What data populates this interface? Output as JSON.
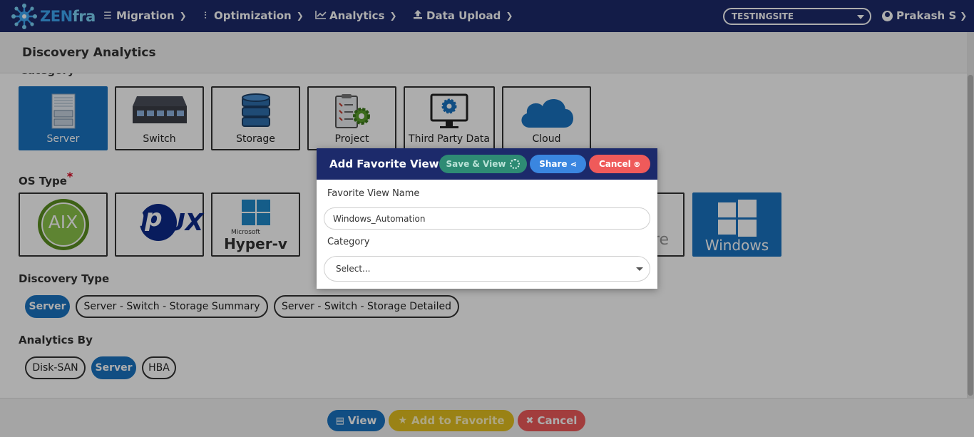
{
  "nav": {
    "logo_primary": "ZEN",
    "logo_secondary": "fra",
    "items": [
      {
        "label": "Migration",
        "icon": "list-icon"
      },
      {
        "label": "Optimization",
        "icon": "sliders-icon"
      },
      {
        "label": "Analytics",
        "icon": "chart-line-icon"
      },
      {
        "label": "Data Upload",
        "icon": "upload-icon"
      }
    ],
    "site_selector": "TESTINGSITE",
    "user_name": "Prakash S"
  },
  "page": {
    "title": "Discovery Analytics",
    "category_label": "Category",
    "categories": [
      {
        "label": "Server",
        "selected": true
      },
      {
        "label": "Switch",
        "selected": false
      },
      {
        "label": "Storage",
        "selected": false
      },
      {
        "label": "Project",
        "selected": false
      },
      {
        "label": "Third Party Data",
        "selected": false
      },
      {
        "label": "Cloud",
        "selected": false
      }
    ],
    "os_type_label": "OS Type",
    "required_marker": "*",
    "os_types": [
      {
        "label": "AIX",
        "selected": false
      },
      {
        "label": "hpux",
        "selected": false
      },
      {
        "label": "Hyper-v",
        "selected": false
      },
      {
        "label": "re",
        "selected": false
      },
      {
        "label": "Windows",
        "selected": true
      }
    ],
    "os_text": {
      "hyperv_brand": "Microsoft",
      "hpux_hp": "hp",
      "hpux_ux": "UX"
    },
    "discovery_type_label": "Discovery Type",
    "discovery_types": [
      {
        "label": "Server",
        "selected": true
      },
      {
        "label": "Server - Switch - Storage Summary",
        "selected": false
      },
      {
        "label": "Server - Switch - Storage Detailed",
        "selected": false
      }
    ],
    "analytics_by_label": "Analytics By",
    "analytics_by": [
      {
        "label": "Disk-SAN",
        "selected": false
      },
      {
        "label": "Server",
        "selected": true
      },
      {
        "label": "HBA",
        "selected": false
      }
    ]
  },
  "footer": {
    "view_label": "View",
    "add_favorite_label": "Add to Favorite",
    "cancel_label": "Cancel",
    "colors": {
      "view": "#175b8c",
      "favorite": "#b59a14",
      "cancel": "#b04040"
    }
  },
  "modal": {
    "title": "Add Favorite View",
    "save_view_label": "Save & View",
    "share_label": "Share",
    "cancel_label": "Cancel",
    "name_label": "Favorite View Name",
    "name_value": "Windows_Automation",
    "category_label": "Category",
    "category_placeholder": "Select..."
  },
  "colors": {
    "nav_bg": "#1c2a6b",
    "selected": "#1a74c2",
    "save_green": "#2e8b74",
    "share_blue": "#3a86e0",
    "cancel_red": "#ef5a5a"
  }
}
